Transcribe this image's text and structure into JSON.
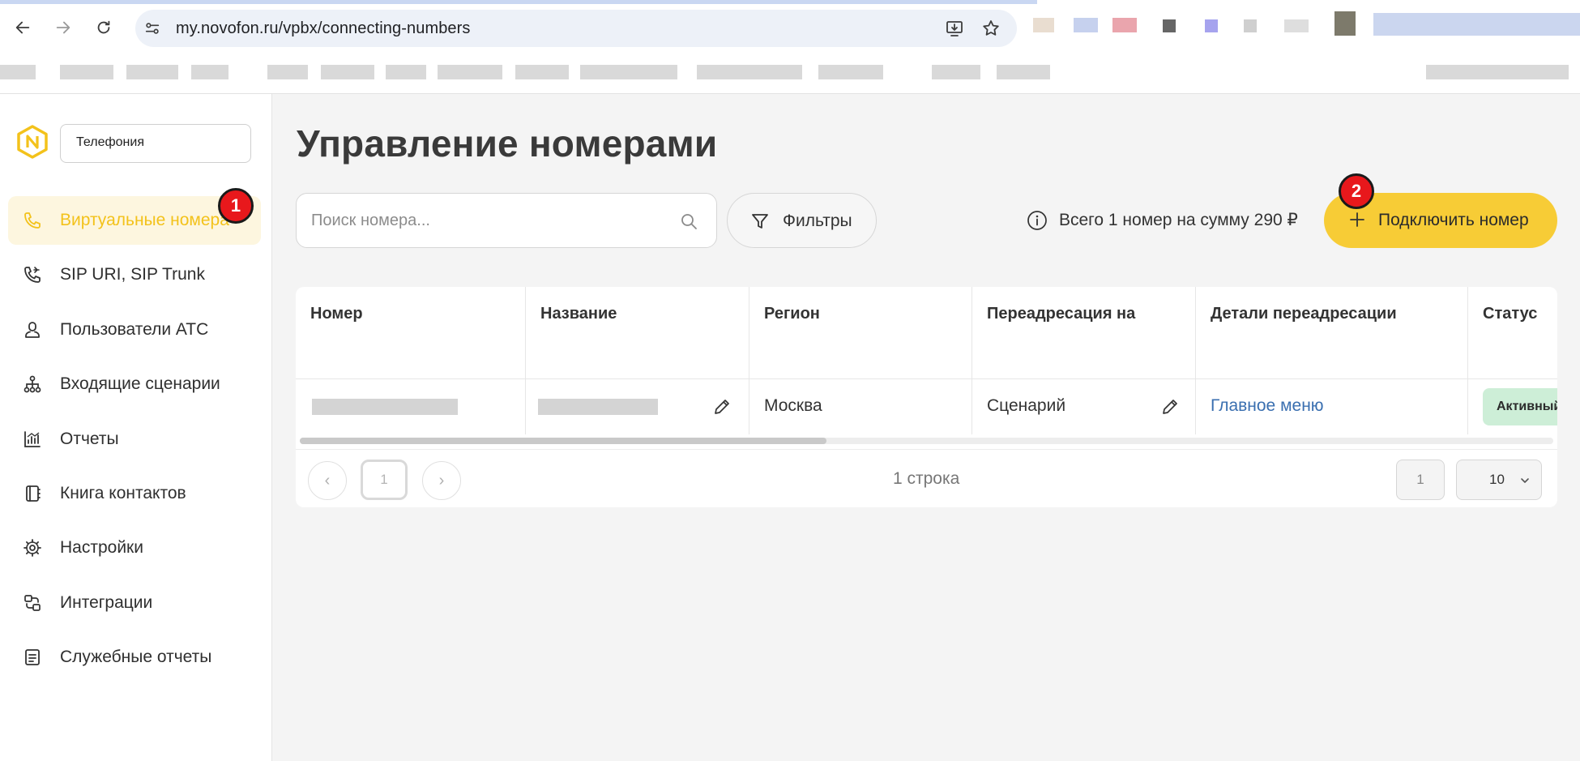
{
  "browser": {
    "url": "my.novofon.ru/vpbx/connecting-numbers"
  },
  "sidebar": {
    "product": "Телефония",
    "items": [
      {
        "label": "Виртуальные номера",
        "icon": "phone-icon",
        "active": true
      },
      {
        "label": "SIP URI, SIP Trunk",
        "icon": "phone-sip-icon",
        "active": false
      },
      {
        "label": "Пользователи АТС",
        "icon": "user-icon",
        "active": false
      },
      {
        "label": "Входящие сценарии",
        "icon": "scenario-tree-icon",
        "active": false
      },
      {
        "label": "Отчеты",
        "icon": "reports-chart-icon",
        "active": false
      },
      {
        "label": "Книга контактов",
        "icon": "contact-book-icon",
        "active": false
      },
      {
        "label": "Настройки",
        "icon": "gear-icon",
        "active": false
      },
      {
        "label": "Интеграции",
        "icon": "integrations-icon",
        "active": false
      },
      {
        "label": "Служебные отчеты",
        "icon": "document-icon",
        "active": false
      }
    ]
  },
  "markers": {
    "one": "1",
    "two": "2"
  },
  "main": {
    "title": "Управление номерами",
    "search_placeholder": "Поиск номера...",
    "filters_label": "Фильтры",
    "summary": "Всего 1 номер на сумму 290 ₽",
    "add_button": "Подключить номер"
  },
  "table": {
    "columns": [
      "Номер",
      "Название",
      "Регион",
      "Переадресация на",
      "Детали переадресации",
      "Статус"
    ],
    "rows": [
      {
        "number": "",
        "name": "",
        "region": "Москва",
        "forward_to": "Сценарий",
        "forward_details": "Главное меню",
        "status": "Активный"
      }
    ],
    "pagination": {
      "prev": "‹",
      "current": "1",
      "next": "›",
      "rows_count": "1 строка",
      "page_input": "1",
      "per_page": "10"
    }
  },
  "colors": {
    "accent": "#f7cc36",
    "active_nav_text": "#f3c21b",
    "active_nav_bg": "#fdf6df",
    "link": "#3a6fb0",
    "status_bg": "#cdeed7",
    "marker": "#e8181c"
  }
}
